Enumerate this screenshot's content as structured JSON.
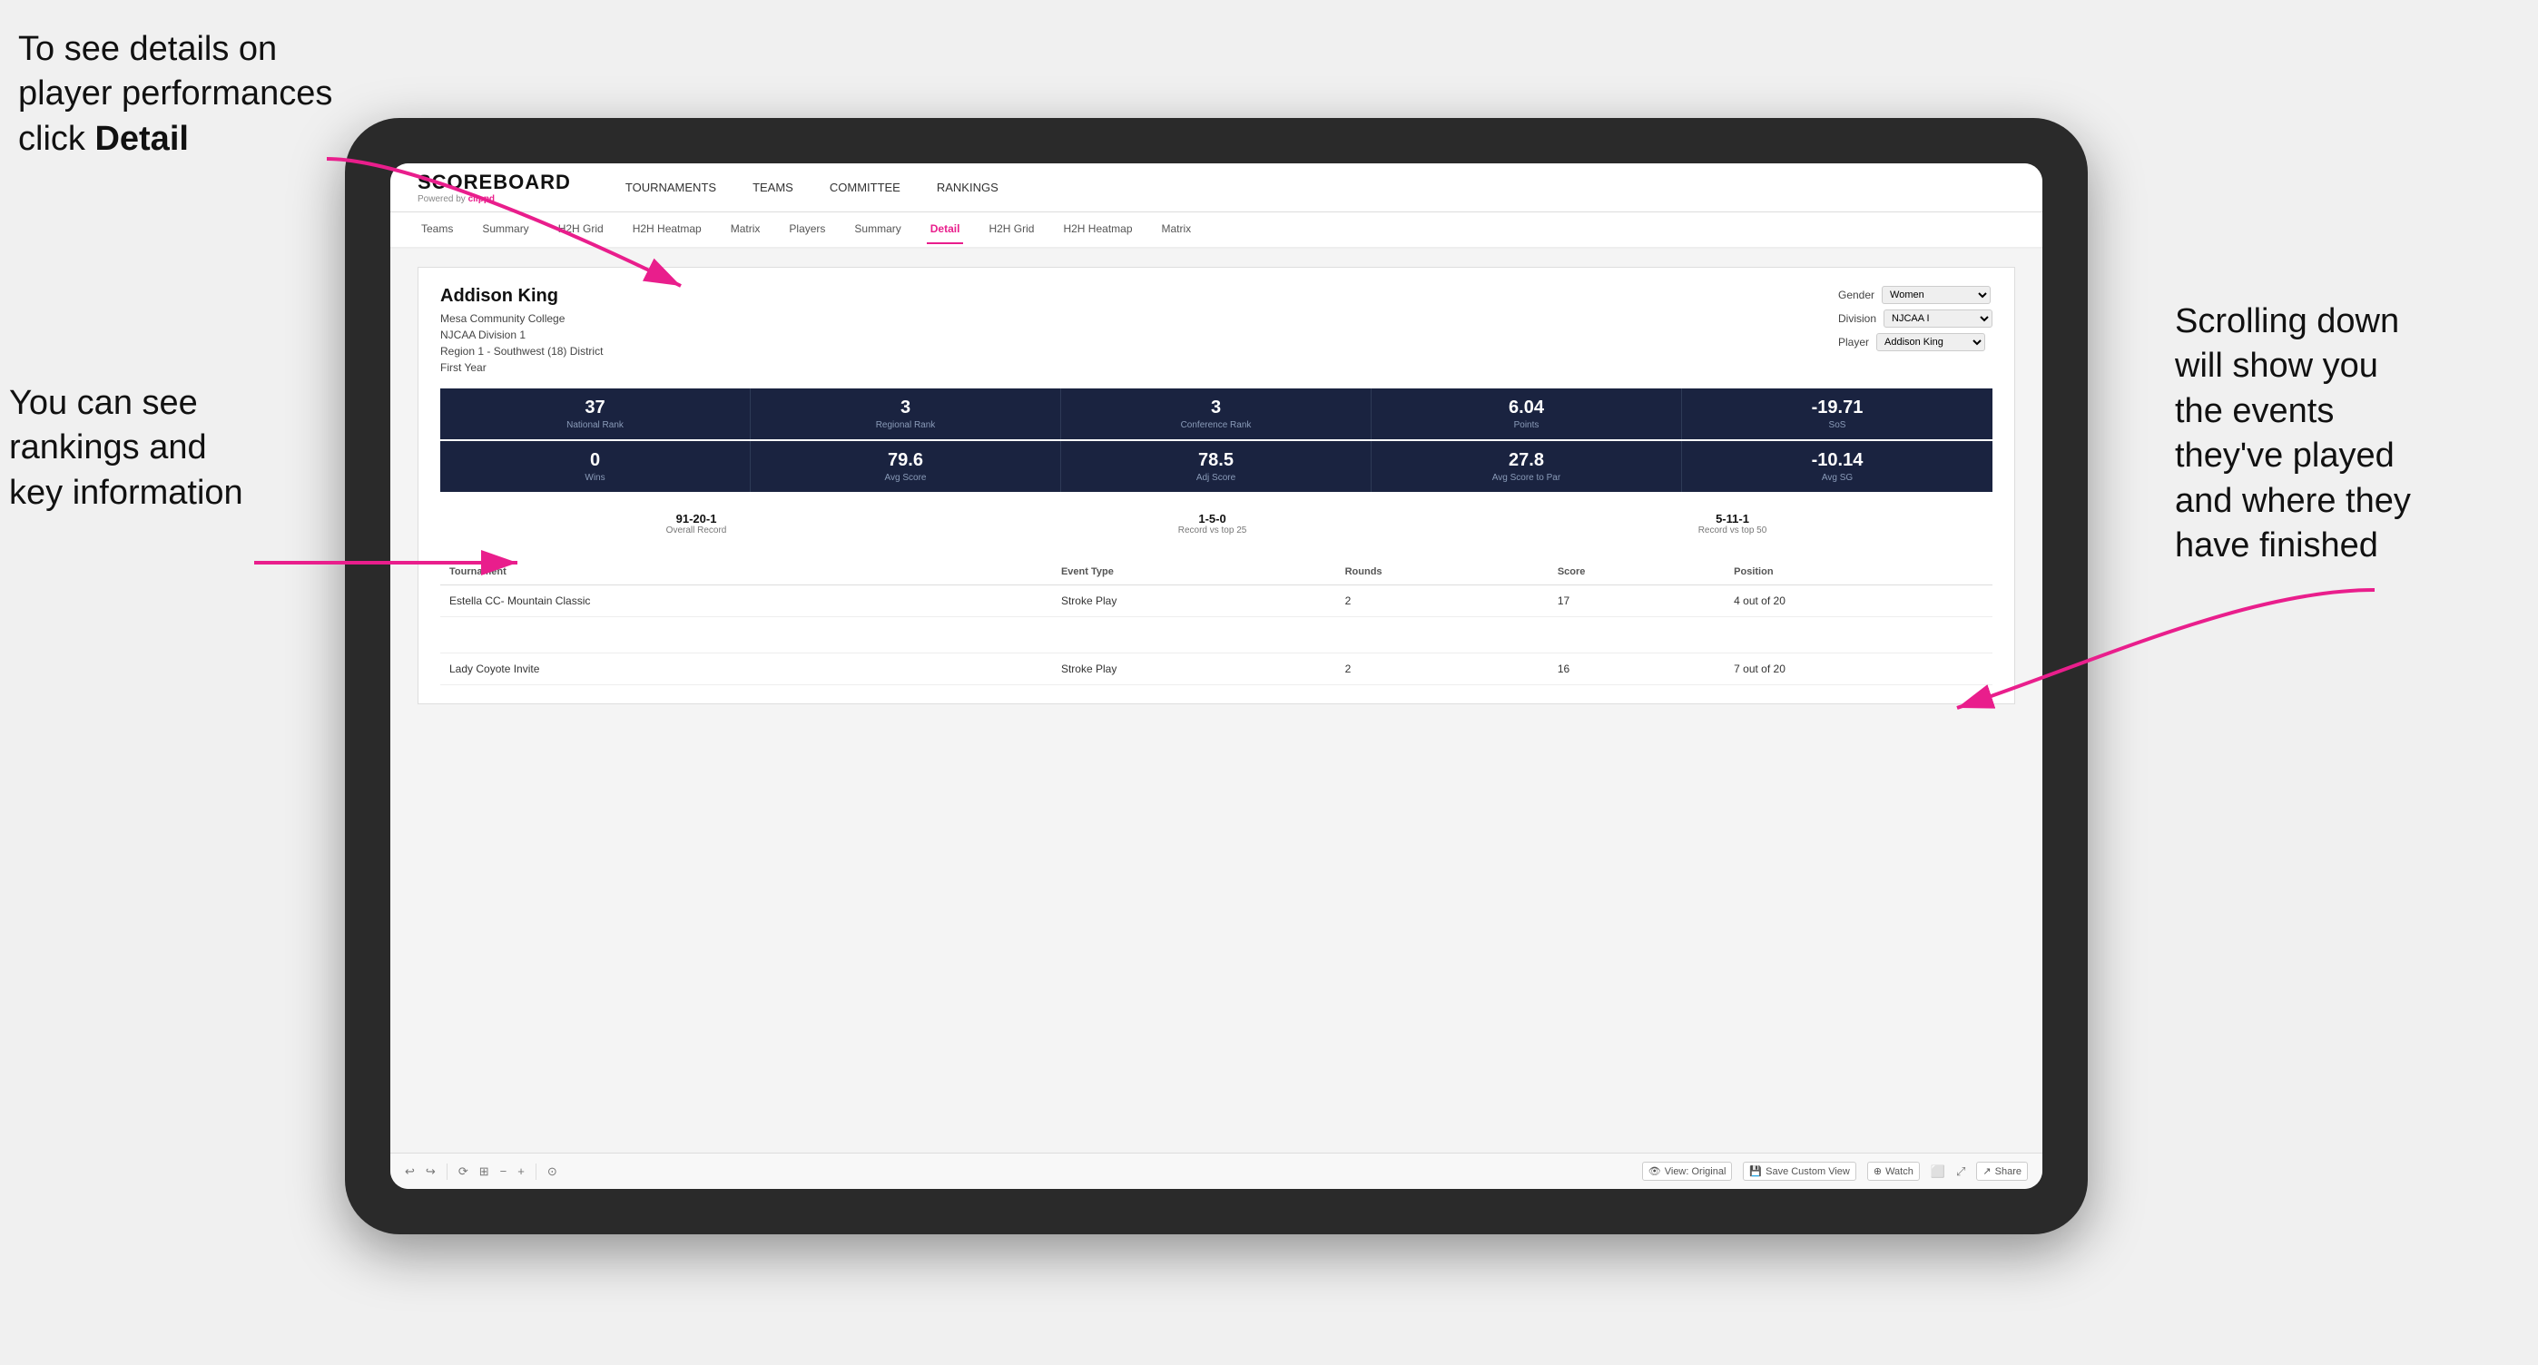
{
  "annotations": {
    "top_left": "To see details on player performances click ",
    "top_left_bold": "Detail",
    "bottom_left_line1": "You can see",
    "bottom_left_line2": "rankings and",
    "bottom_left_line3": "key information",
    "right_line1": "Scrolling down",
    "right_line2": "will show you",
    "right_line3": "the events",
    "right_line4": "they've played",
    "right_line5": "and where they",
    "right_line6": "have finished"
  },
  "nav": {
    "logo": "SCOREBOARD",
    "powered_by": "Powered by ",
    "brand": "clippd",
    "items": [
      "TOURNAMENTS",
      "TEAMS",
      "COMMITTEE",
      "RANKINGS"
    ]
  },
  "subnav": {
    "items": [
      "Teams",
      "Summary",
      "H2H Grid",
      "H2H Heatmap",
      "Matrix",
      "Players",
      "Summary",
      "Detail",
      "H2H Grid",
      "H2H Heatmap",
      "Matrix"
    ],
    "active_index": 7
  },
  "player": {
    "name": "Addison King",
    "college": "Mesa Community College",
    "division": "NJCAA Division 1",
    "region": "Region 1 - Southwest (18) District",
    "year": "First Year",
    "filters": {
      "gender_label": "Gender",
      "gender_value": "Women",
      "division_label": "Division",
      "division_value": "NJCAA I",
      "player_label": "Player",
      "player_value": "Addison King"
    }
  },
  "stats_row1": [
    {
      "value": "37",
      "label": "National Rank"
    },
    {
      "value": "3",
      "label": "Regional Rank"
    },
    {
      "value": "3",
      "label": "Conference Rank"
    },
    {
      "value": "6.04",
      "label": "Points"
    },
    {
      "value": "-19.71",
      "label": "SoS"
    }
  ],
  "stats_row2": [
    {
      "value": "0",
      "label": "Wins"
    },
    {
      "value": "79.6",
      "label": "Avg Score"
    },
    {
      "value": "78.5",
      "label": "Adj Score"
    },
    {
      "value": "27.8",
      "label": "Avg Score to Par"
    },
    {
      "value": "-10.14",
      "label": "Avg SG"
    }
  ],
  "records": [
    {
      "value": "91-20-1",
      "label": "Overall Record"
    },
    {
      "value": "1-5-0",
      "label": "Record vs top 25"
    },
    {
      "value": "5-11-1",
      "label": "Record vs top 50"
    }
  ],
  "table": {
    "headers": [
      "Tournament",
      "Event Type",
      "Rounds",
      "Score",
      "Position"
    ],
    "rows": [
      {
        "tournament": "Estella CC- Mountain Classic",
        "event_type": "Stroke Play",
        "rounds": "2",
        "score": "17",
        "position": "4 out of 20"
      },
      {
        "tournament": "",
        "event_type": "",
        "rounds": "",
        "score": "",
        "position": ""
      },
      {
        "tournament": "Lady Coyote Invite",
        "event_type": "Stroke Play",
        "rounds": "2",
        "score": "16",
        "position": "7 out of 20"
      }
    ]
  },
  "toolbar": {
    "view_label": "View: Original",
    "save_label": "Save Custom View",
    "watch_label": "Watch",
    "share_label": "Share"
  }
}
